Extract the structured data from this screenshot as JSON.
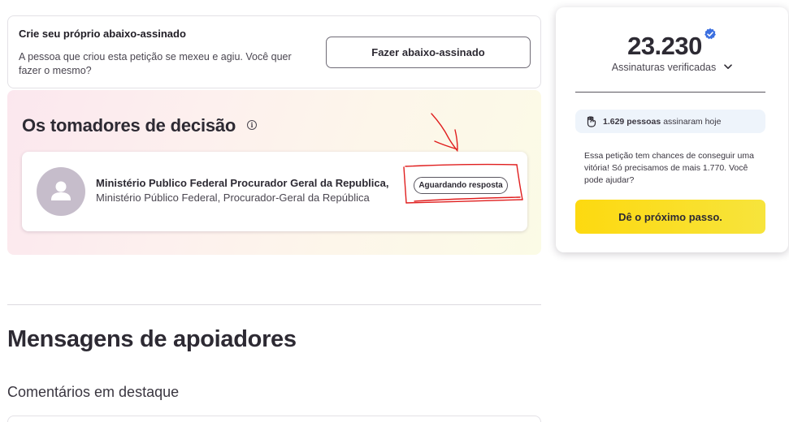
{
  "create_petition": {
    "title": "Crie seu próprio abaixo-assinado",
    "description": "A pessoa que criou esta petição se mexeu e agiu. Você quer fazer o mesmo?",
    "button_label": "Fazer abaixo-assinado"
  },
  "decision_makers": {
    "title": "Os tomadores de decisão",
    "info_icon": "info-icon",
    "items": [
      {
        "name": "Ministério Publico Federal Procurador Geral da Republica,",
        "role": "Ministério Público Federal, Procurador-Geral da República",
        "status": "Aguardando resposta",
        "avatar_icon": "person-icon"
      }
    ]
  },
  "supporters": {
    "title": "Mensagens de apoiadores",
    "featured_label": "Comentários em destaque"
  },
  "sidebar": {
    "signature_count": "23.230",
    "verified_label": "Assinaturas verificadas",
    "today_count": "1.629 pessoas",
    "today_suffix": "assinaram hoje",
    "chance_text": "Essa petição tem chances de conseguir uma vitória! Só precisamos de mais 1.770. Você pode ajudar?",
    "next_step_label": "Dê o próximo passo."
  },
  "colors": {
    "accent_yellow": "#fdd910",
    "verified_blue": "#3b6fe0",
    "annotation_red": "#e01e1e",
    "pill_bg": "#eef4fb"
  }
}
